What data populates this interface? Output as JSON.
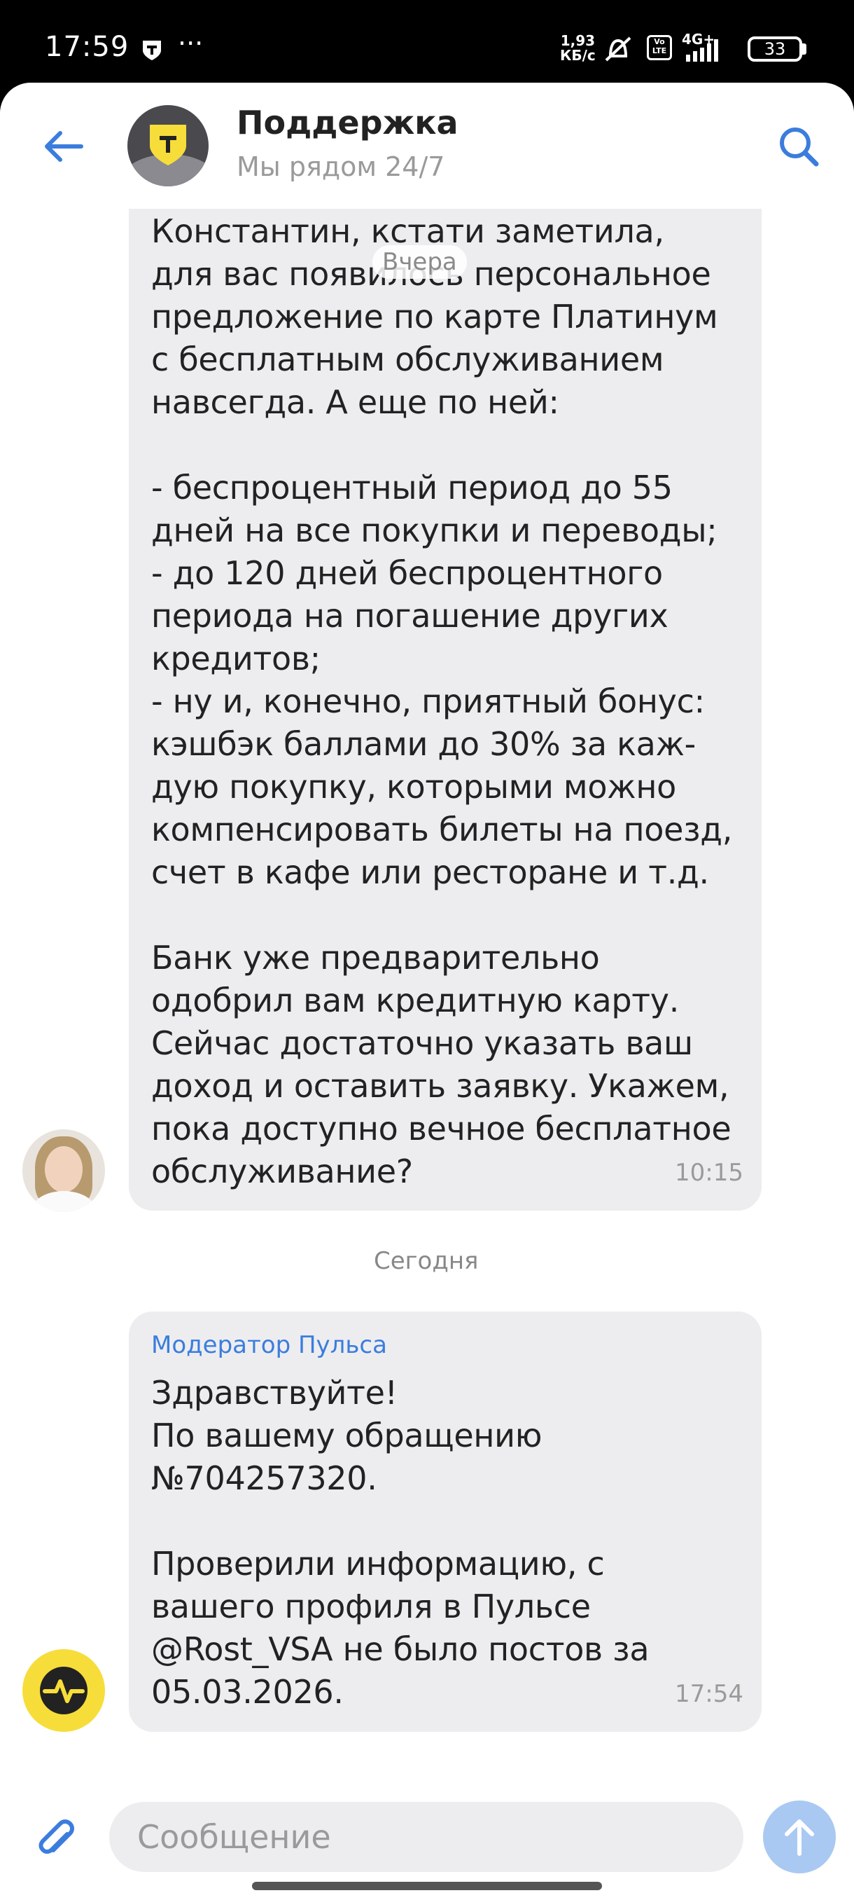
{
  "status_bar": {
    "time": "17:59",
    "dots": "···",
    "net_speed_value": "1,93",
    "net_speed_unit": "КБ/с",
    "volte_label": "Vo\nLTE",
    "network_label": "4G+",
    "battery": "33"
  },
  "header": {
    "title": "Поддержка",
    "subtitle": "Мы рядом 24/7",
    "back_icon": "arrow-left-icon",
    "search_icon": "search-icon"
  },
  "messages": [
    {
      "text": "Константин, кстати заметила,\nдля вас появилось персональное\nпредложение по карте Платинум\nс бесплатным обслуживанием\nнавсегда. А еще по ней:\n\n- беспроцентный период до 55\nдней на все покупки и переводы;\n- до 120 дней беспроцентного\nпериода на погашение других\nкредитов;\n- ну и, конечно, приятный бонус:\nкэшбэк баллами до 30% за каж-\nдую покупку, которыми можно\nкомпенсировать билеты на поезд,\nсчет в кафе или ресторане и т.д.\n\nБанк уже предварительно\nодобрил вам кредитную карту.\nСейчас достаточно указать ваш\nдоход и оставить заявку. Укажем,\nпока доступно вечное бесплатное\nобслуживание?",
      "time": "10:15"
    },
    {
      "sender": "Модератор Пульса",
      "text": "Здравствуйте!\nПо вашему обращению\n№704257320.\n\nПроверили информацию, с\nвашего профиля в Пульсе\n@Rost_VSA не было постов за\n05.03.2026.",
      "time": "17:54"
    }
  ],
  "date_labels": {
    "yesterday": "Вчера",
    "today": "Сегодня"
  },
  "input": {
    "placeholder": "Сообщение",
    "value": ""
  },
  "colors": {
    "accent": "#3b7ddd",
    "bubble": "#ededf0",
    "send_button": "#a9c9f2",
    "brand_yellow": "#f7dd3a"
  }
}
